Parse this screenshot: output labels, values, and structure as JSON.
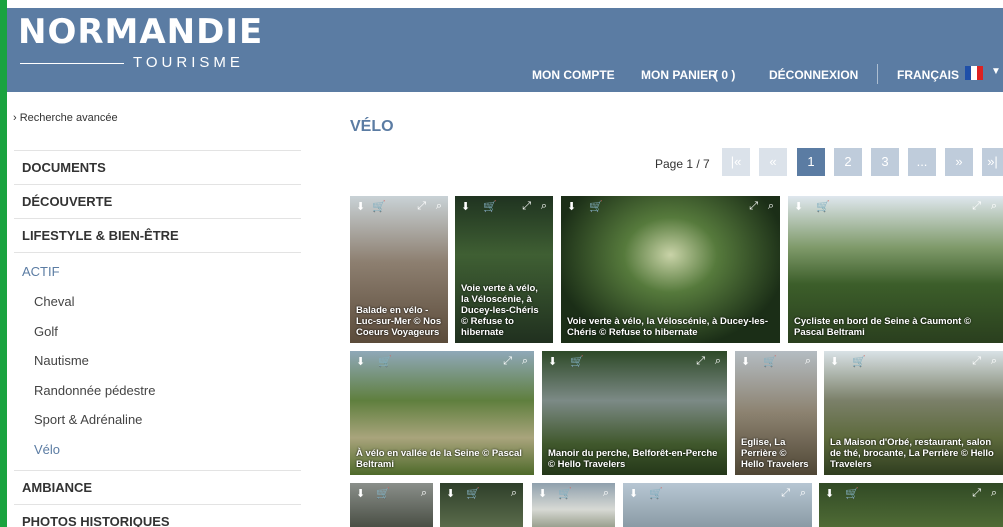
{
  "header": {
    "logo_title": "NORMANDIE",
    "logo_subtitle": "TOURISME",
    "nav": {
      "account": "MON COMPTE",
      "cart": "MON PANIER",
      "cart_count": "( 0 )",
      "logout": "DÉCONNEXION",
      "language": "FRANÇAIS"
    }
  },
  "sidebar": {
    "advanced_search": "› Recherche avancée",
    "items": [
      {
        "label": "DOCUMENTS"
      },
      {
        "label": "DÉCOUVERTE"
      },
      {
        "label": "LIFESTYLE & BIEN-ÊTRE"
      },
      {
        "label": "ACTIF"
      },
      {
        "label": "AMBIANCE"
      },
      {
        "label": "PHOTOS HISTORIQUES"
      }
    ],
    "subitems": [
      "Cheval",
      "Golf",
      "Nautisme",
      "Randonnée pédestre",
      "Sport & Adrénaline",
      "Vélo"
    ]
  },
  "main": {
    "title": "VÉLO",
    "page_info": "Page 1 / 7",
    "pager": {
      "first": "|«",
      "prev": "«",
      "p1": "1",
      "p2": "2",
      "p3": "3",
      "ellipsis": "...",
      "next": "»",
      "last": "»|"
    },
    "captions": [
      "Balade en vélo - Luc-sur-Mer © Nos Coeurs Voyageurs",
      "Voie verte à vélo, la Véloscénie, à Ducey-les-Chéris © Refuse to hibernate",
      "Voie verte à vélo, la Véloscénie, à Ducey-les-Chéris © Refuse to hibernate",
      "Cycliste en bord de Seine à Caumont © Pascal Beltrami",
      "À vélo en vallée de la Seine © Pascal Beltrami",
      "Manoir du perche, Belforêt-en-Perche © Hello Travelers",
      "Eglise, La Perrière © Hello Travelers",
      "La Maison d'Orbé, restaurant, salon de thé, brocante, La Perrière © Hello Travelers"
    ]
  },
  "colors": {
    "brand_blue": "#5b7ca3",
    "green_strip": "#1aa33f"
  }
}
